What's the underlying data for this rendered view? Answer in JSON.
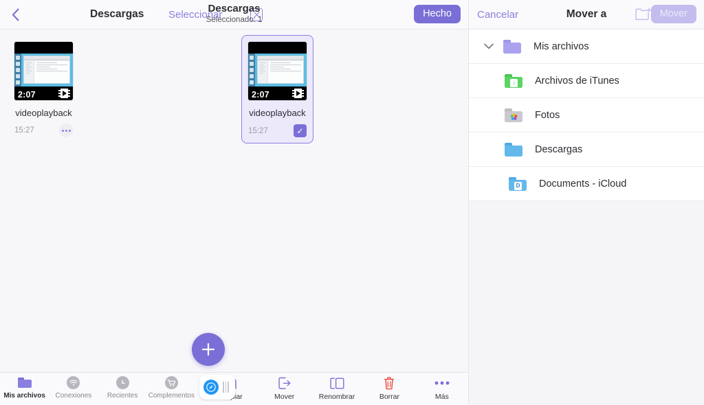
{
  "left_panel": {
    "header": {
      "back_icon": "chevron-left-icon",
      "breadcrumb_title": "Descargas",
      "select_link": "Seleccionar",
      "close_icon": "close-box-icon",
      "center_title": "Descargas",
      "center_subtitle": "Seleccionado: 1",
      "done_label": "Hecho"
    },
    "files": [
      {
        "name": "videoplayback",
        "time": "15:27",
        "duration": "2:07",
        "kind": "video",
        "selected": false,
        "more_icon": "more-dots-icon"
      },
      {
        "name": "videoplayback",
        "time": "15:27",
        "duration": "2:07",
        "kind": "video",
        "selected": true,
        "check_glyph": "✓"
      }
    ],
    "fab": {
      "icon": "plus-icon",
      "label": "Añadir"
    },
    "tabs": [
      {
        "label": "Mis archivos",
        "icon": "folder-icon",
        "active": true
      },
      {
        "label": "Conexiones",
        "icon": "wifi-icon",
        "active": false
      },
      {
        "label": "Recientes",
        "icon": "clock-icon",
        "active": false
      },
      {
        "label": "Complementos",
        "icon": "cart-icon",
        "active": false
      }
    ],
    "multitask_pill": {
      "app_icon": "safari-compass-icon",
      "grip_icon": "drag-handle-icon"
    },
    "actions": [
      {
        "label": "Copiar",
        "icon": "copy-icon",
        "color": "#7a6fd6"
      },
      {
        "label": "Mover",
        "icon": "move-arrow-icon",
        "color": "#7a6fd6"
      },
      {
        "label": "Renombrar",
        "icon": "rename-icon",
        "color": "#7a6fd6"
      },
      {
        "label": "Borrar",
        "icon": "trash-icon",
        "color": "#f0443a"
      },
      {
        "label": "Más",
        "icon": "more-dots-icon",
        "color": "#7a6fd6"
      }
    ]
  },
  "right_panel": {
    "header": {
      "cancel_label": "Cancelar",
      "title": "Mover a",
      "new_folder_icon": "new-folder-icon",
      "move_label": "Mover",
      "move_enabled": false
    },
    "tree": [
      {
        "label": "Mis archivos",
        "icon": "folder-icon",
        "color": "#aba2ef",
        "level": 0,
        "expandable": true,
        "chevron": "chevron-down-icon",
        "emblem": ""
      },
      {
        "label": "Archivos de iTunes",
        "icon": "folder-icon",
        "color": "#5cd463",
        "level": 1,
        "expandable": false,
        "chevron": "",
        "emblem": "itunes-icon"
      },
      {
        "label": "Fotos",
        "icon": "folder-icon",
        "color": "#c9c9cf",
        "level": 1,
        "expandable": false,
        "chevron": "",
        "emblem": "photos-icon"
      },
      {
        "label": "Descargas",
        "icon": "folder-icon",
        "color": "#63b8ec",
        "level": 1,
        "expandable": false,
        "chevron": "",
        "emblem": ""
      },
      {
        "label": "Documents - iCloud",
        "icon": "folder-icon",
        "color": "#63b8ec",
        "level": 0,
        "expandable": false,
        "chevron": "",
        "emblem": "D"
      }
    ]
  },
  "colors": {
    "accent_purple": "#7a6fd6",
    "accent_purple_light": "#8a80e0",
    "disabled_purple": "#c3bdee",
    "danger_red": "#f0443a",
    "panel_bg": "#f7f7fa",
    "selected_card_bg": "#ece9fb"
  }
}
